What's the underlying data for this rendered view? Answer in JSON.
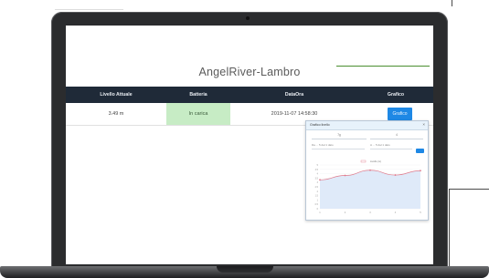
{
  "app": {
    "title": "AngelRiver-Lambro"
  },
  "table": {
    "headers": [
      "Livello Attuale",
      "Batteria",
      "DataOra",
      "Grafico"
    ],
    "row": {
      "level": "3.49 m",
      "battery": "In carica",
      "datetime": "2019-11-07 14:58:30",
      "chart_button": "Grafico"
    }
  },
  "modal": {
    "title": "Grafico livello",
    "close_label": "×",
    "period_select": "7g",
    "second_select": "4",
    "from_placeholder": "Da ... 5 dal 1 dato",
    "to_placeholder": "A ... 5 dal 1 dato"
  },
  "colors": {
    "header_bg": "#1f2a38",
    "battery_bg": "#c7ecc5",
    "button": "#1e88e5",
    "series": "#e07a8b",
    "area": "#dfeaf9"
  },
  "chart_data": {
    "type": "area",
    "legend": "Livello (m)",
    "x": [
      "1",
      "2",
      "3",
      "4",
      "5"
    ],
    "series": [
      {
        "name": "Livello (m)",
        "values": [
          3.3,
          3.8,
          4.4,
          3.85,
          4.35
        ]
      }
    ],
    "ylim": [
      0,
      5
    ],
    "yticks": [
      0,
      0.5,
      1,
      1.5,
      2,
      2.5,
      3,
      3.5,
      4,
      4.5,
      5
    ],
    "grid": true
  }
}
